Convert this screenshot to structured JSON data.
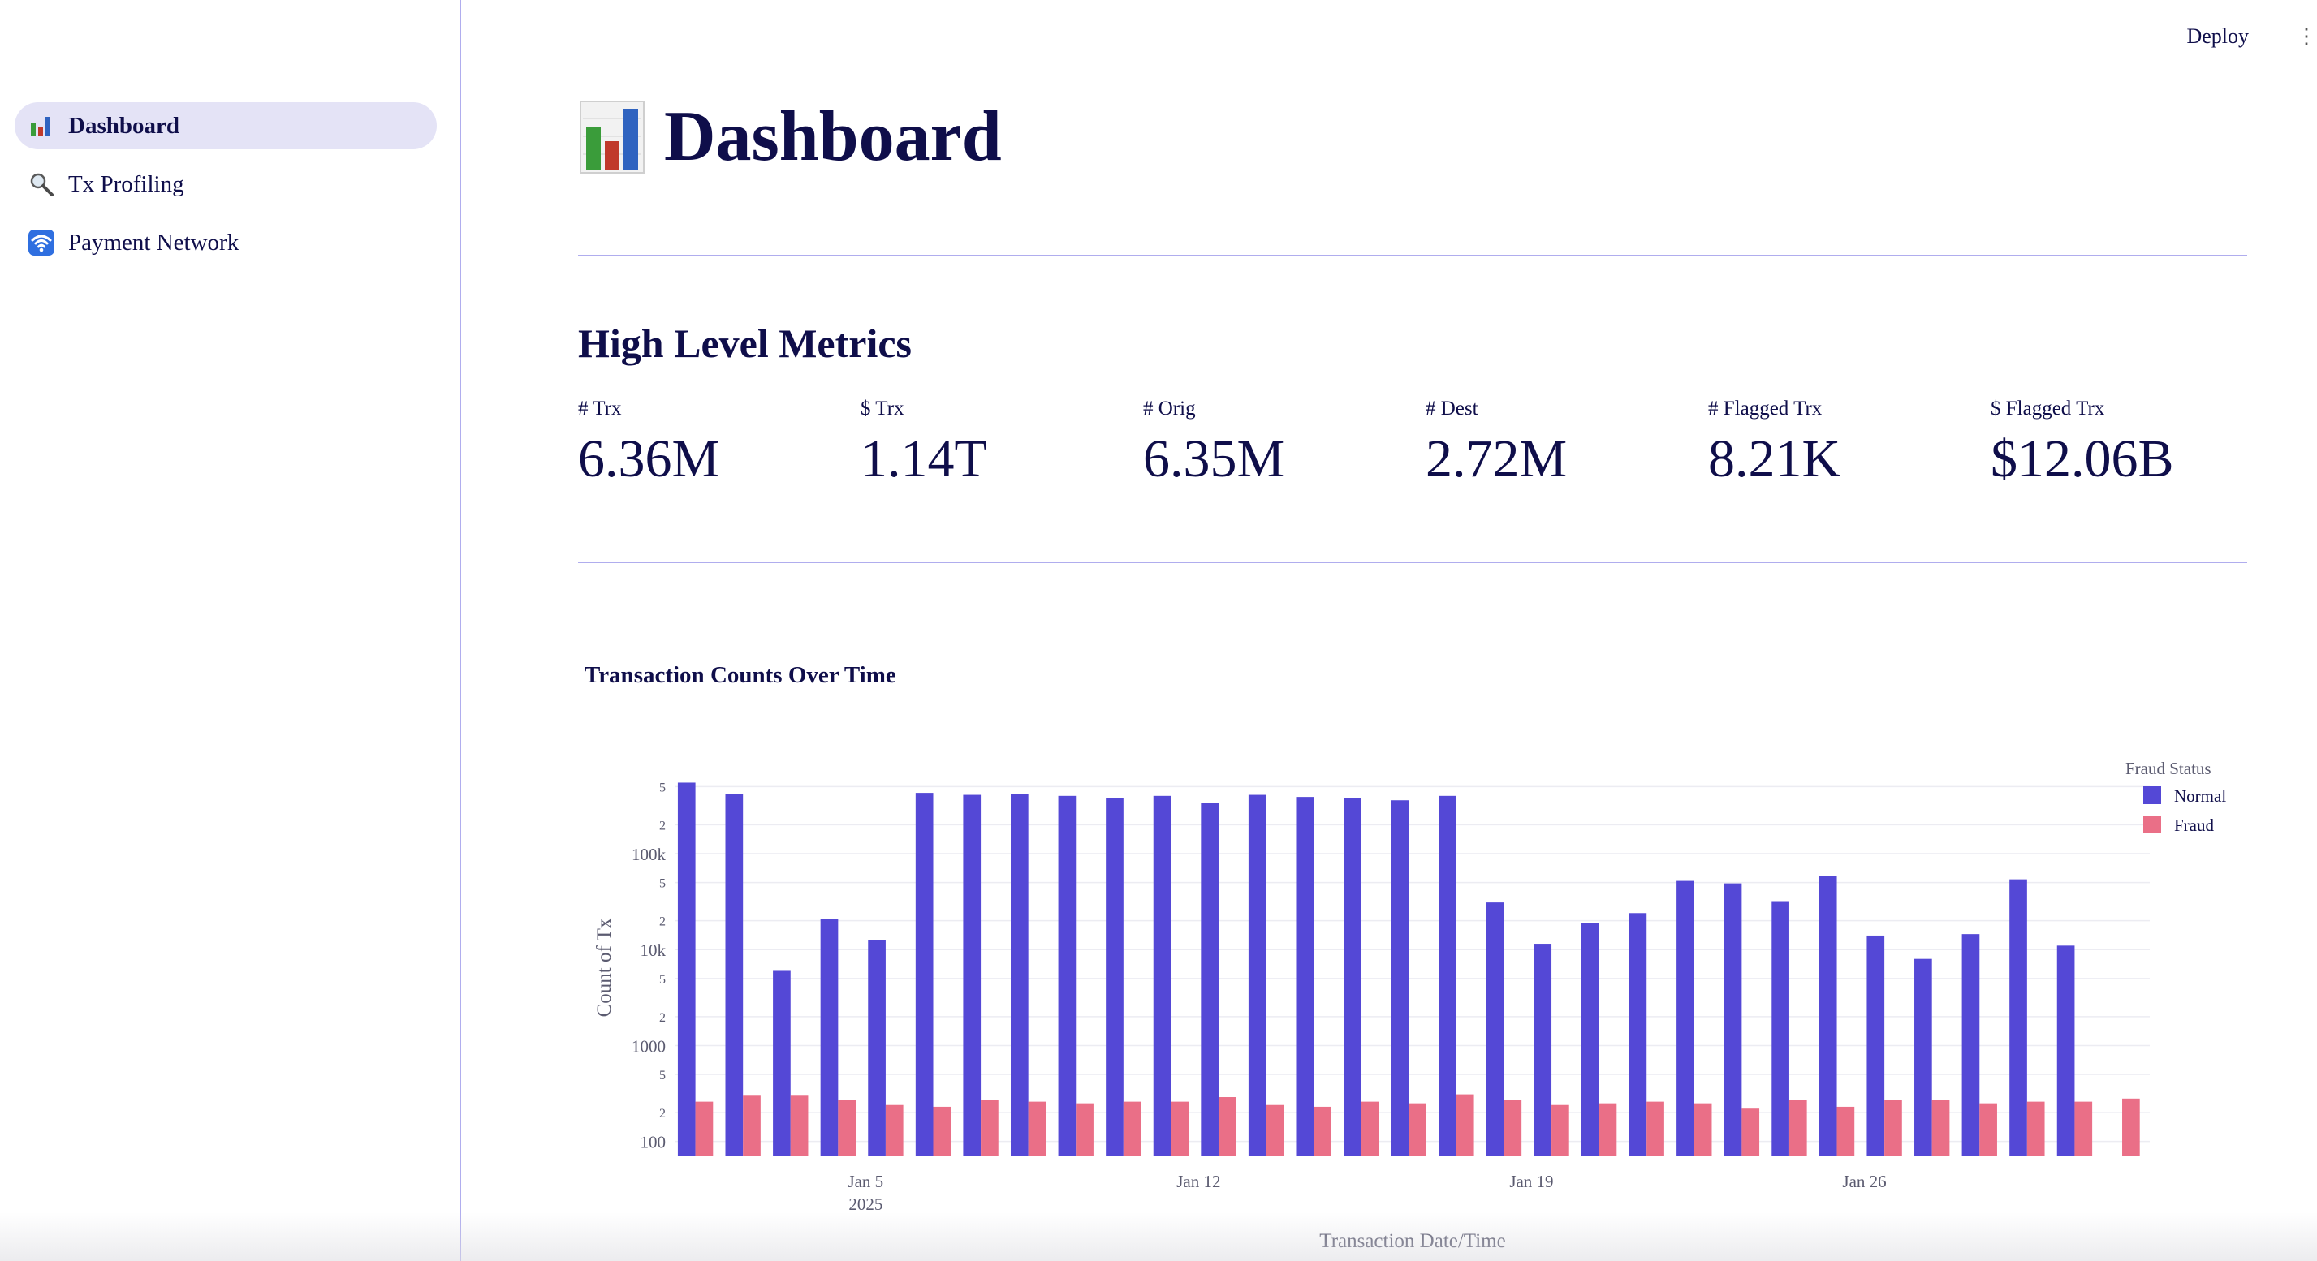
{
  "sidebar": {
    "items": [
      {
        "label": "Dashboard",
        "icon": "bar-chart-icon",
        "active": true
      },
      {
        "label": "Tx Profiling",
        "icon": "magnifier-icon",
        "active": false
      },
      {
        "label": "Payment Network",
        "icon": "wifi-icon",
        "active": false
      }
    ]
  },
  "header": {
    "deploy_label": "Deploy",
    "menu_glyph": "⋮"
  },
  "page": {
    "title": "Dashboard"
  },
  "metrics": {
    "section_title": "High Level Metrics",
    "items": [
      {
        "label": "# Trx",
        "value": "6.36M"
      },
      {
        "label": "$ Trx",
        "value": "1.14T"
      },
      {
        "label": "# Orig",
        "value": "6.35M"
      },
      {
        "label": "# Dest",
        "value": "2.72M"
      },
      {
        "label": "# Flagged Trx",
        "value": "8.21K"
      },
      {
        "label": "$ Flagged Trx",
        "value": "$12.06B"
      }
    ]
  },
  "chart_data": {
    "type": "bar",
    "title": "Transaction Counts Over Time",
    "xlabel": "Transaction Date/Time",
    "ylabel": "Count of Tx",
    "yscale": "log",
    "ylim": [
      70,
      600000
    ],
    "grid": true,
    "legend_title": "Fraud Status",
    "legend_position": "top-right",
    "x_tick_labels": [
      "Jan 5",
      "Jan 12",
      "Jan 19",
      "Jan 26"
    ],
    "x_tick_year": "2025",
    "y_tick_labels": [
      "100",
      "2",
      "5",
      "1000",
      "2",
      "5",
      "10k",
      "2",
      "5",
      "100k",
      "2",
      "5"
    ],
    "categories": [
      "2025-01-01",
      "2025-01-02",
      "2025-01-03",
      "2025-01-04",
      "2025-01-05",
      "2025-01-06",
      "2025-01-07",
      "2025-01-08",
      "2025-01-09",
      "2025-01-10",
      "2025-01-11",
      "2025-01-12",
      "2025-01-13",
      "2025-01-14",
      "2025-01-15",
      "2025-01-16",
      "2025-01-17",
      "2025-01-18",
      "2025-01-19",
      "2025-01-20",
      "2025-01-21",
      "2025-01-22",
      "2025-01-23",
      "2025-01-24",
      "2025-01-25",
      "2025-01-26",
      "2025-01-27",
      "2025-01-28",
      "2025-01-29",
      "2025-01-30",
      "2025-01-31"
    ],
    "series": [
      {
        "name": "Normal",
        "color": "#5448d6",
        "values": [
          550000,
          420000,
          6000,
          21000,
          12500,
          430000,
          410000,
          420000,
          400000,
          380000,
          400000,
          340000,
          410000,
          390000,
          380000,
          360000,
          400000,
          31000,
          11500,
          19000,
          24000,
          52000,
          49000,
          32000,
          58000,
          14000,
          8000,
          14500,
          54000,
          11000,
          0
        ]
      },
      {
        "name": "Fraud",
        "color": "#ea6f87",
        "values": [
          260,
          300,
          300,
          270,
          240,
          230,
          270,
          260,
          250,
          260,
          260,
          290,
          240,
          230,
          260,
          250,
          310,
          270,
          240,
          250,
          260,
          250,
          220,
          270,
          230,
          270,
          270,
          250,
          260,
          260,
          280
        ]
      }
    ]
  }
}
